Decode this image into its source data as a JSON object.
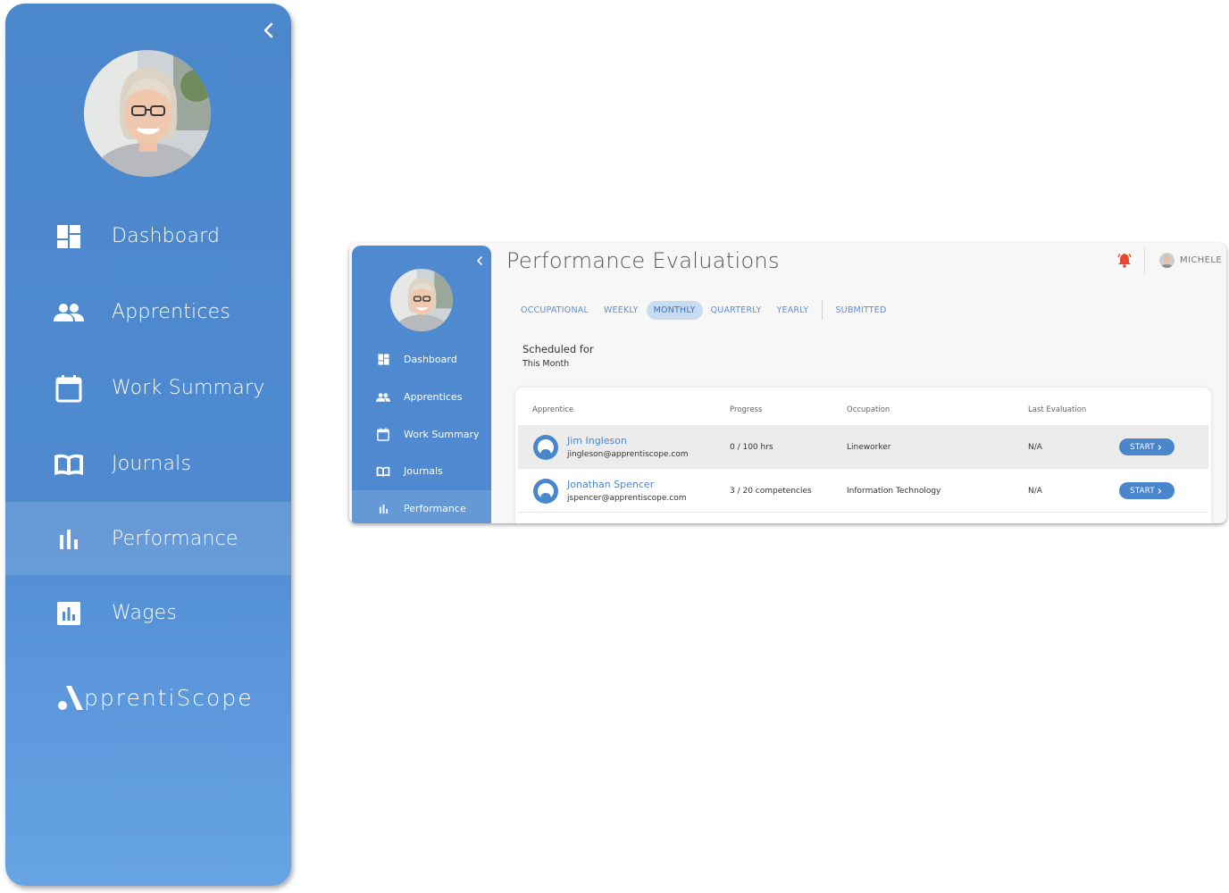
{
  "big_sidebar": {
    "items": [
      {
        "label": "Dashboard",
        "icon": "dashboard-icon"
      },
      {
        "label": "Apprentices",
        "icon": "people-icon"
      },
      {
        "label": "Work Summary",
        "icon": "calendar-icon"
      },
      {
        "label": "Journals",
        "icon": "book-icon"
      },
      {
        "label": "Performance",
        "icon": "bar-chart-icon",
        "active": true
      },
      {
        "label": "Wages",
        "icon": "chart-box-icon"
      }
    ],
    "logo_text": "pprentiScope"
  },
  "app": {
    "sidebar": {
      "items": [
        {
          "label": "Dashboard"
        },
        {
          "label": "Apprentices"
        },
        {
          "label": "Work Summary"
        },
        {
          "label": "Journals"
        },
        {
          "label": "Performance",
          "active": true
        }
      ]
    },
    "title": "Performance Evaluations",
    "user": {
      "name": "MICHELE"
    },
    "tabs": [
      {
        "label": "OCCUPATIONAL"
      },
      {
        "label": "WEEKLY"
      },
      {
        "label": "MONTHLY",
        "active": true
      },
      {
        "label": "QUARTERLY"
      },
      {
        "label": "YEARLY"
      },
      {
        "label": "SUBMITTED"
      }
    ],
    "scheduled": {
      "heading": "Scheduled for",
      "period": "This Month"
    },
    "table": {
      "headers": {
        "apprentice": "Apprentice",
        "progress": "Progress",
        "occupation": "Occupation",
        "last_eval": "Last Evaluation"
      },
      "rows": [
        {
          "name": "Jim Ingleson",
          "email": "jingleson@apprentiscope.com",
          "progress": "0 / 100 hrs",
          "occupation": "Lineworker",
          "last_eval": "N/A",
          "action": "START"
        },
        {
          "name": "Jonathan Spencer",
          "email": "jspencer@apprentiscope.com",
          "progress": "3 / 20 competencies",
          "occupation": "Information Technology",
          "last_eval": "N/A",
          "action": "START"
        }
      ]
    }
  },
  "colors": {
    "brand_blue": "#4f8ad0",
    "link_blue": "#4a86cc",
    "alert_red": "#e8472f"
  }
}
